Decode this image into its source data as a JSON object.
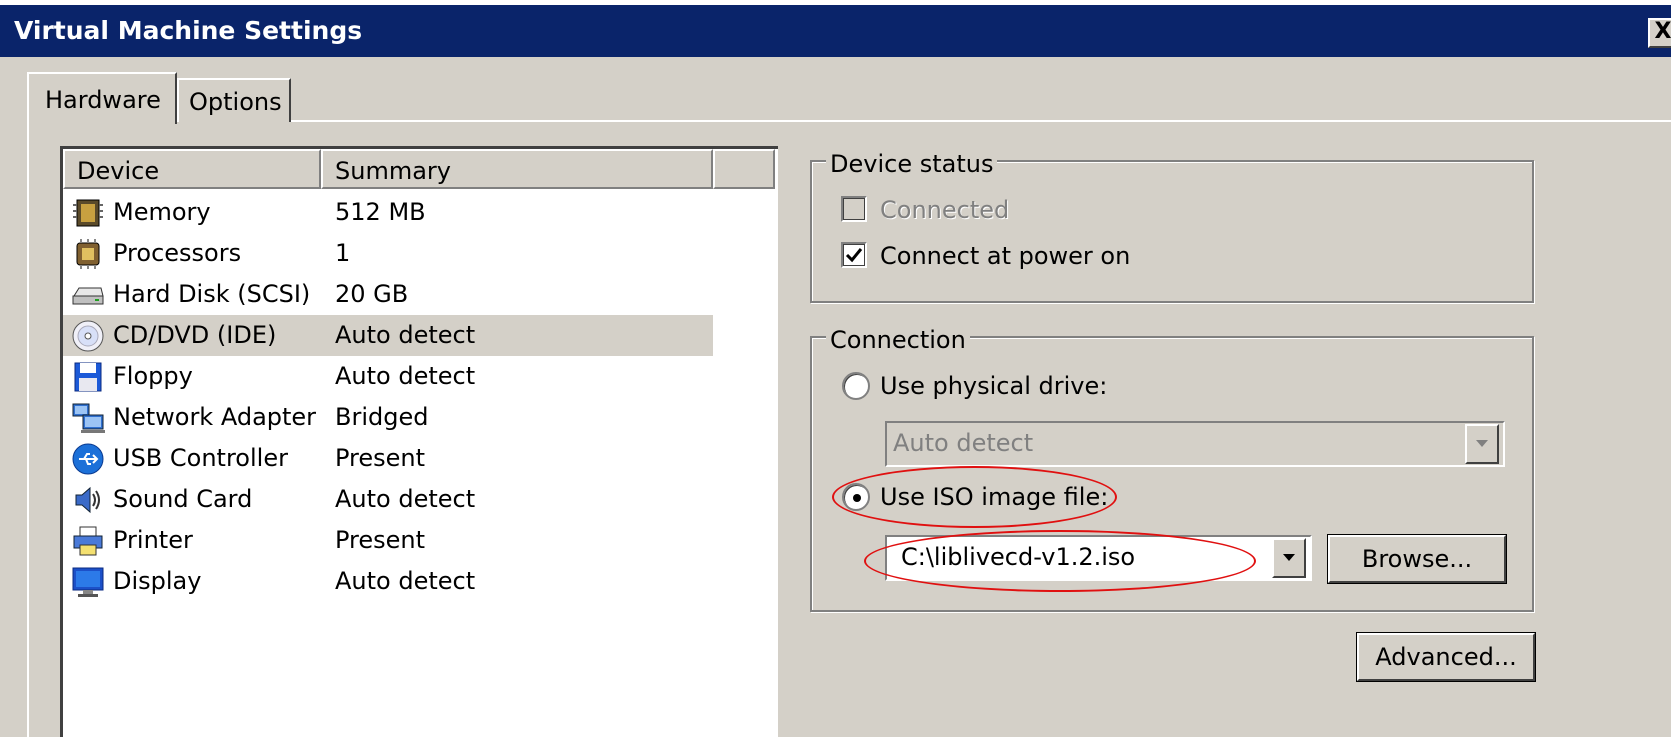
{
  "window": {
    "title": "Virtual Machine Settings",
    "close_glyph": "X"
  },
  "tabs": [
    {
      "label": "Hardware",
      "selected": true
    },
    {
      "label": "Options",
      "selected": false
    }
  ],
  "device_list": {
    "columns": [
      "Device",
      "Summary"
    ],
    "rows": [
      {
        "icon": "memory-icon",
        "device": "Memory",
        "summary": "512 MB"
      },
      {
        "icon": "processor-icon",
        "device": "Processors",
        "summary": "1"
      },
      {
        "icon": "hard-disk-icon",
        "device": "Hard Disk (SCSI)",
        "summary": "20 GB"
      },
      {
        "icon": "cd-dvd-icon",
        "device": "CD/DVD (IDE)",
        "summary": "Auto detect",
        "selected": true
      },
      {
        "icon": "floppy-icon",
        "device": "Floppy",
        "summary": "Auto detect"
      },
      {
        "icon": "network-adapter-icon",
        "device": "Network Adapter",
        "summary": "Bridged"
      },
      {
        "icon": "usb-icon",
        "device": "USB Controller",
        "summary": "Present"
      },
      {
        "icon": "sound-card-icon",
        "device": "Sound Card",
        "summary": "Auto detect"
      },
      {
        "icon": "printer-icon",
        "device": "Printer",
        "summary": "Present"
      },
      {
        "icon": "display-icon",
        "device": "Display",
        "summary": "Auto detect"
      }
    ]
  },
  "device_status": {
    "legend": "Device status",
    "connected": {
      "label": "Connected",
      "checked": false,
      "disabled": true
    },
    "connect_at_power_on": {
      "label": "Connect at power on",
      "checked": true
    }
  },
  "connection": {
    "legend": "Connection",
    "use_physical_drive": {
      "label": "Use physical drive:",
      "selected": false
    },
    "physical_drive_value": "Auto detect",
    "use_iso": {
      "label": "Use ISO image file:",
      "selected": true
    },
    "iso_path": "C:\\liblivecd-v1.2.iso",
    "browse_label": "Browse..."
  },
  "advanced_label": "Advanced...",
  "colors": {
    "titlebar": "#0a246a",
    "face": "#d4d0c8",
    "annotation": "#e01010"
  }
}
